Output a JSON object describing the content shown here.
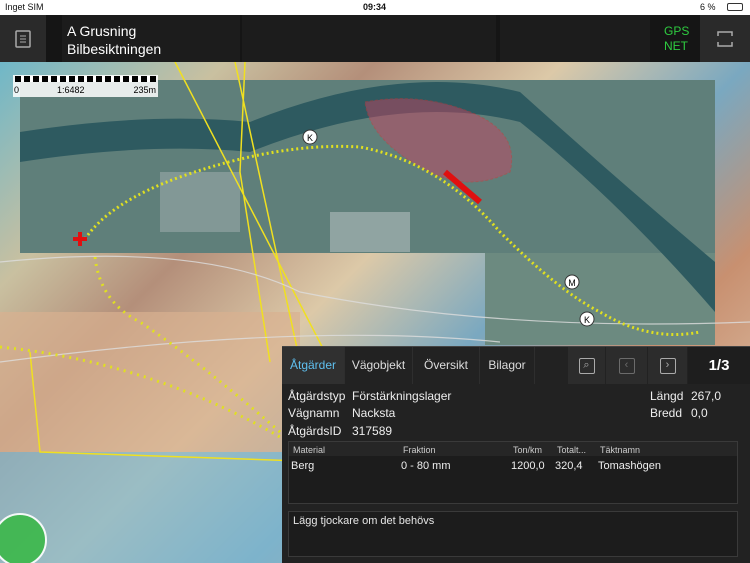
{
  "status_bar": {
    "carrier": "Inget SIM",
    "time": "09:34",
    "battery": "6 %"
  },
  "header": {
    "title_line1": "A Grusning",
    "title_line2": "Bilbesiktningen",
    "gps_line1": "GPS",
    "gps_line2": "NET"
  },
  "map": {
    "scale_ratio": "1:6482",
    "scale_start": "0",
    "scale_end": "235m",
    "markers": [
      "K",
      "M",
      "K"
    ]
  },
  "panel": {
    "tabs": [
      {
        "label": "Åtgärder"
      },
      {
        "label": "Vägobjekt"
      },
      {
        "label": "Översikt"
      },
      {
        "label": "Bilagor"
      }
    ],
    "page": "1/3",
    "fields": {
      "type_label": "Åtgärdstyp",
      "type_value": "Förstärkningslager",
      "road_label": "Vägnamn",
      "road_value": "Nacksta",
      "id_label": "ÅtgärdsID",
      "id_value": "317589",
      "length_label": "Längd",
      "length_value": "267,0",
      "width_label": "Bredd",
      "width_value": "0,0"
    },
    "table": {
      "headers": [
        "Material",
        "Fraktion",
        "Ton/km",
        "Totalt...",
        "Täktnamn"
      ],
      "rows": [
        [
          "Berg",
          "0 - 80 mm",
          "1200,0",
          "320,4",
          "Tomashögen"
        ]
      ]
    },
    "notes": "Lägg tjockare om det behövs"
  },
  "colors": {
    "accent": "#5fc0f0",
    "gps": "#2ecc40"
  }
}
